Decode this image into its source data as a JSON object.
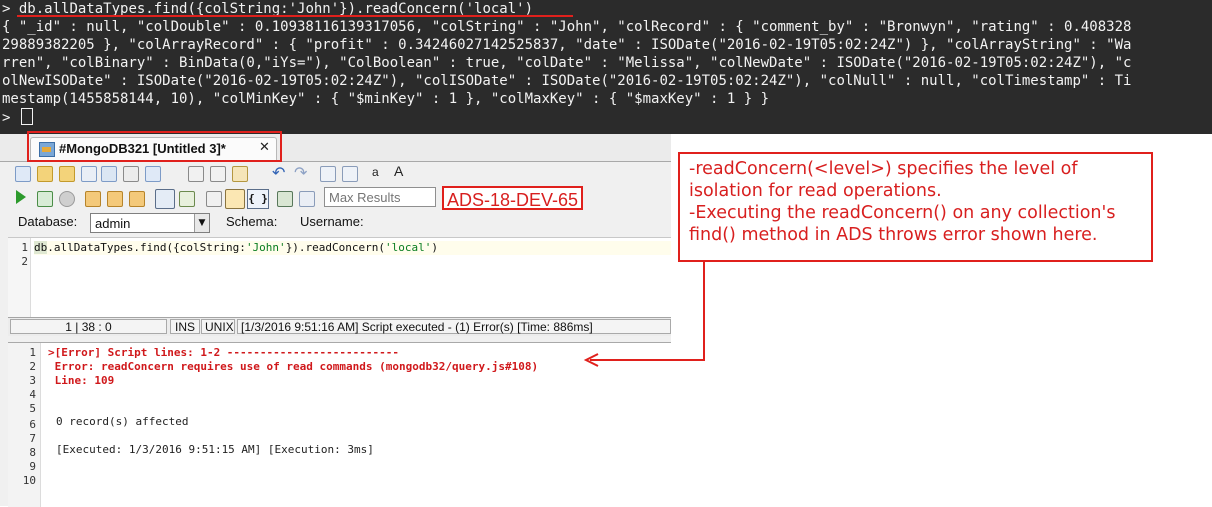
{
  "terminal": {
    "prompt": ">",
    "command": "db.allDataTypes.find({colString:'John'}).readConcern('local')",
    "output_lines": [
      "{ \"_id\" : null, \"colDouble\" : 0.10938116139317056, \"colString\" : \"John\", \"colRecord\" : { \"comment_by\" : \"Bronwyn\", \"rating\" : 0.408328",
      "29889382205 }, \"colArrayRecord\" : { \"profit\" : 0.34246027142525837, \"date\" : ISODate(\"2016-02-19T05:02:24Z\") }, \"colArrayString\" : \"Wa",
      "rren\", \"colBinary\" : BinData(0,\"iYs=\"), \"ColBoolean\" : true, \"colDate\" : \"Melissa\", \"colNewDate\" : ISODate(\"2016-02-19T05:02:24Z\"), \"c",
      "olNewISODate\" : ISODate(\"2016-02-19T05:02:24Z\"), \"colISODate\" : ISODate(\"2016-02-19T05:02:24Z\"), \"colNull\" : null, \"colTimestamp\" : Ti",
      "mestamp(1455858144, 10), \"colMinKey\" : { \"$minKey\" : 1 }, \"colMaxKey\" : { \"$maxKey\" : 1 } }"
    ],
    "prompt2": ">"
  },
  "tab": {
    "label": "#MongoDB321 [Untitled 3]*",
    "close": "✕"
  },
  "toolbar": {
    "max_results_placeholder": "Max Results",
    "server_label": "ADS-18-DEV-65",
    "font_smaller": "a",
    "font_larger": "A",
    "braces": "{ }"
  },
  "connection": {
    "database_label": "Database:",
    "database_value": "admin",
    "schema_label": "Schema:",
    "username_label": "Username:"
  },
  "editor": {
    "line_numbers": [
      "1",
      "2"
    ],
    "code_prefix": ".allDataTypes.find({colString:",
    "code_db": "db",
    "code_str1": "'John'",
    "code_mid": "}).readConcern(",
    "code_str2": "'local'",
    "code_end": ")"
  },
  "status": {
    "position": "1 | 38 : 0",
    "ins": "INS",
    "eol": "UNIX",
    "message": "[1/3/2016 9:51:16 AM] Script executed - (1) Error(s) [Time: 886ms]"
  },
  "output": {
    "line_numbers": [
      "1",
      "2",
      "3",
      "4",
      "5",
      "6",
      "7",
      "8",
      "9",
      "10"
    ],
    "error_header": ">[Error] Script lines: 1-2 --------------------------",
    "error_msg": " Error: readConcern requires use of read commands (mongodb32/query.js#108)",
    "error_line": " Line: 109",
    "affected": "0 record(s) affected",
    "executed": "[Executed: 1/3/2016 9:51:15 AM] [Execution: 3ms]"
  },
  "annotation": {
    "line1": "-readConcern(<level>) specifies the level of",
    "line2": "isolation for read operations.",
    "line3": "-Executing the readConcern() on any collection's",
    "line4": "find() method in ADS throws error shown here."
  },
  "colors": {
    "annotation_red": "#e0201c",
    "terminal_bg": "#2b2b2b",
    "error_red": "#d0181b"
  }
}
